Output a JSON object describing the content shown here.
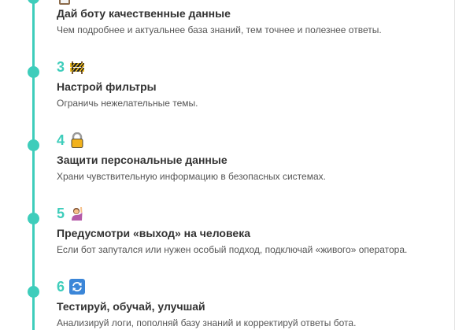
{
  "steps": [
    {
      "number": "",
      "icon": "clipboard-icon",
      "title": "Дай боту качественные данные",
      "description": "Чем подробнее и актуальнее база знаний, тем точнее и полезнее ответы."
    },
    {
      "number": "3",
      "icon": "construction-barrier-icon",
      "title": "Настрой фильтры",
      "description": "Ограничь нежелательные темы."
    },
    {
      "number": "4",
      "icon": "lock-icon",
      "title": "Защити персональные данные",
      "description": "Храни чувствительную информацию в безопасных системах."
    },
    {
      "number": "5",
      "icon": "person-raising-hand-icon",
      "title": "Предусмотри «выход» на человека",
      "description": "Если бот запутался или нужен особый подход, подключай «живого» оператора."
    },
    {
      "number": "6",
      "icon": "refresh-arrows-icon",
      "title": "Тестируй, обучай, улучшай",
      "description": "Анализируй логи, пополняй базу знаний и корректируй ответы бота."
    }
  ],
  "colors": {
    "accent": "#3ecdbb",
    "title": "#333333",
    "description": "#555555"
  }
}
